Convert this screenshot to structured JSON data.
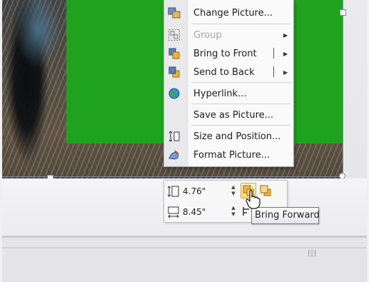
{
  "context_menu": {
    "items": [
      {
        "label": "Change Picture...",
        "icon": "change-picture-icon",
        "disabled": false,
        "submenu": false
      },
      {
        "label": "Group",
        "icon": "group-icon",
        "disabled": true,
        "submenu": true
      },
      {
        "label": "Bring to Front",
        "icon": "bring-to-front-icon",
        "disabled": false,
        "submenu": true
      },
      {
        "label": "Send to Back",
        "icon": "send-to-back-icon",
        "disabled": false,
        "submenu": true
      },
      {
        "label": "Hyperlink...",
        "icon": "hyperlink-globe-icon",
        "disabled": false,
        "submenu": false
      },
      {
        "label": "Save as Picture...",
        "icon": "",
        "disabled": false,
        "submenu": false
      },
      {
        "label": "Size and Position...",
        "icon": "size-position-icon",
        "disabled": false,
        "submenu": false
      },
      {
        "label": "Format Picture...",
        "icon": "format-picture-icon",
        "disabled": false,
        "submenu": false
      }
    ]
  },
  "mini_toolbar": {
    "height_value": "4.76\"",
    "width_value": "8.45\"",
    "bring_forward_icon": "bring-forward-icon",
    "send_backward_icon": "send-backward-icon"
  },
  "tooltip": {
    "text": "Bring Forward"
  },
  "colors": {
    "fill_green": "#1fa31f",
    "tooltip_border": "#767676",
    "button_highlight": "#ffd77a"
  }
}
